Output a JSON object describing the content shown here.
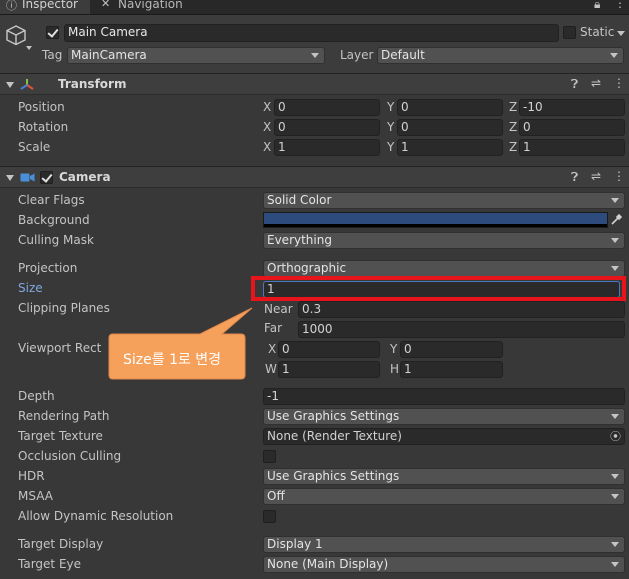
{
  "tabs": {
    "inspector": "Inspector",
    "navigation": "Navigation"
  },
  "object": {
    "name": "Main Camera",
    "static_label": "Static",
    "tag_label": "Tag",
    "tag_value": "MainCamera",
    "layer_label": "Layer",
    "layer_value": "Default"
  },
  "transform": {
    "title": "Transform",
    "rows": [
      {
        "label": "Position",
        "x": "0",
        "y": "0",
        "z": "-10"
      },
      {
        "label": "Rotation",
        "x": "0",
        "y": "0",
        "z": "0"
      },
      {
        "label": "Scale",
        "x": "1",
        "y": "1",
        "z": "1"
      }
    ]
  },
  "axes": {
    "x": "X",
    "y": "Y",
    "z": "Z"
  },
  "camera": {
    "title": "Camera",
    "clear_flags_label": "Clear Flags",
    "clear_flags_value": "Solid Color",
    "background_label": "Background",
    "background_color": "#2e4b7e",
    "culling_mask_label": "Culling Mask",
    "culling_mask_value": "Everything",
    "projection_label": "Projection",
    "projection_value": "Orthographic",
    "size_label": "Size",
    "size_value": "1",
    "clipping_label": "Clipping Planes",
    "near_label": "Near",
    "near_value": "0.3",
    "far_label": "Far",
    "far_value": "1000",
    "viewport_label": "Viewport Rect",
    "viewport": {
      "x_label": "X",
      "x": "0",
      "y_label": "Y",
      "y": "0",
      "w_label": "W",
      "w": "1",
      "h_label": "H",
      "h": "1"
    },
    "depth_label": "Depth",
    "depth_value": "-1",
    "rendering_path_label": "Rendering Path",
    "rendering_path_value": "Use Graphics Settings",
    "target_texture_label": "Target Texture",
    "target_texture_value": "None (Render Texture)",
    "occlusion_label": "Occlusion Culling",
    "hdr_label": "HDR",
    "hdr_value": "Use Graphics Settings",
    "msaa_label": "MSAA",
    "msaa_value": "Off",
    "dynamic_res_label": "Allow Dynamic Resolution",
    "target_display_label": "Target Display",
    "target_display_value": "Display 1",
    "target_eye_label": "Target Eye",
    "target_eye_value": "None (Main Display)"
  },
  "annotation": {
    "callout_text": "Size를 1로 변경",
    "highlight_color": "#e8141b",
    "callout_color": "#f5a15c"
  }
}
